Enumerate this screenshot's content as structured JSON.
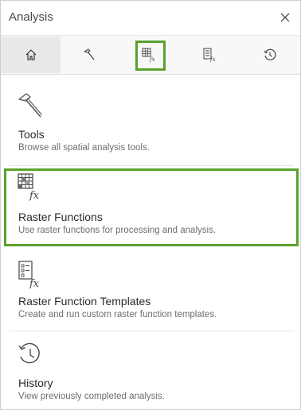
{
  "header": {
    "title": "Analysis",
    "close_icon": "close-icon"
  },
  "tabs": [
    {
      "icon": "home-icon",
      "selected": true
    },
    {
      "icon": "hammer-icon",
      "selected": false
    },
    {
      "icon": "raster-functions-icon",
      "selected": false,
      "highlighted": true
    },
    {
      "icon": "raster-function-templates-icon",
      "selected": false
    },
    {
      "icon": "history-icon",
      "selected": false
    }
  ],
  "items": [
    {
      "label": "Tools",
      "description": "Browse all spatial analysis tools.",
      "icon": "hammer-icon"
    },
    {
      "label": "Raster Functions",
      "description": "Use raster functions for processing and analysis.",
      "icon": "raster-functions-icon",
      "highlighted": true
    },
    {
      "label": "Raster Function Templates",
      "description": "Create and run custom raster function templates.",
      "icon": "raster-function-templates-icon"
    },
    {
      "label": "History",
      "description": "View previously completed analysis.",
      "icon": "history-icon"
    }
  ],
  "colors": {
    "highlight": "#59a12c",
    "text": "#2b2b2b",
    "muted": "#6e6e6e"
  }
}
